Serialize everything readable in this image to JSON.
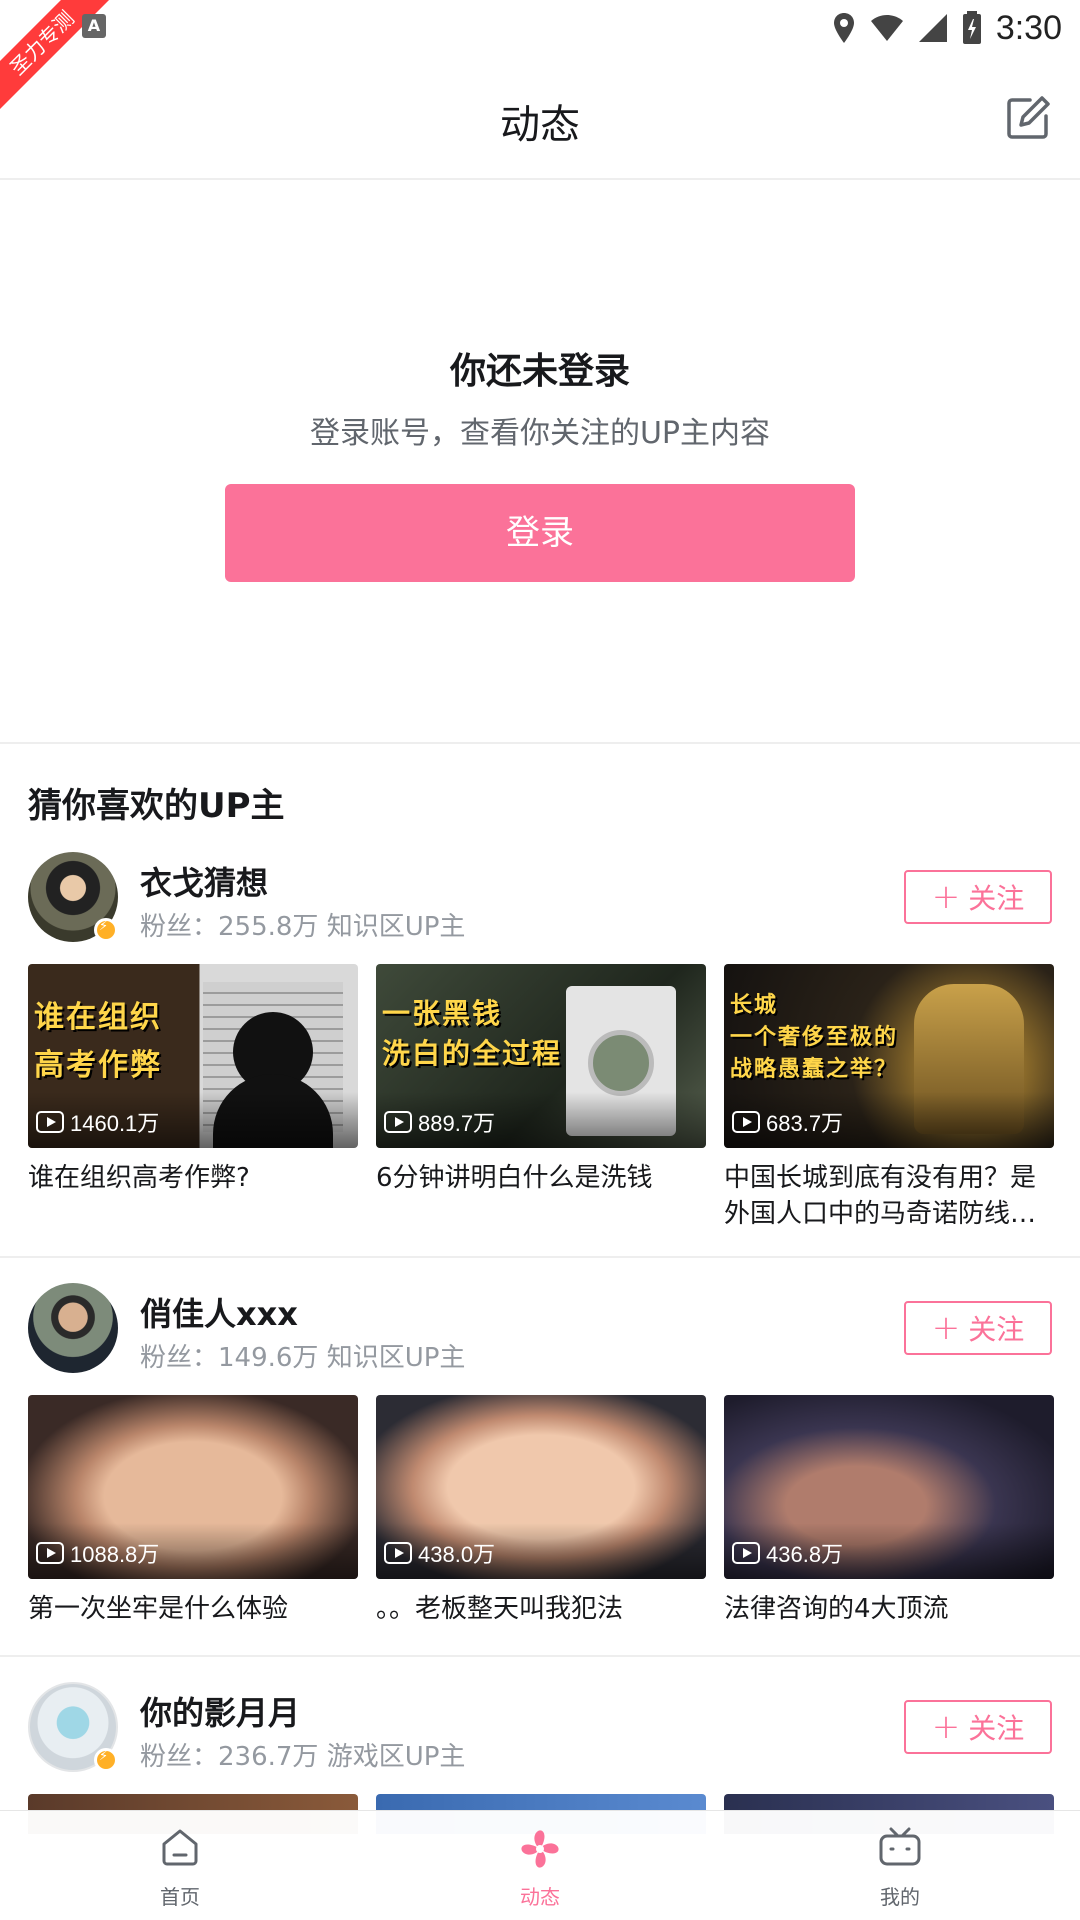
{
  "status_bar": {
    "ribbon": "圣力专测",
    "time": "3:30"
  },
  "header": {
    "title": "动态"
  },
  "login": {
    "title": "你还未登录",
    "subtitle": "登录账号，查看你关注的UP主内容",
    "button": "登录"
  },
  "recommend": {
    "title": "猜你喜欢的UP主",
    "follow_label": "关注",
    "ups": [
      {
        "name": "衣戈猜想",
        "meta": "粉丝：255.8万 知识区UP主",
        "videos": [
          {
            "thumb_text": "谁在组织\n高考作弊",
            "views": "1460.1万",
            "title": "谁在组织高考作弊?"
          },
          {
            "thumb_text": "一张黑钱\n洗白的全过程",
            "views": "889.7万",
            "title": "6分钟讲明白什么是洗钱"
          },
          {
            "thumb_text": "长城\n一个奢侈至极的\n战略愚蠢之举？",
            "views": "683.7万",
            "title": "中国长城到底有没有用？是外国人口中的马奇诺防线…"
          }
        ]
      },
      {
        "name": "俏佳人xxx",
        "meta": "粉丝：149.6万 知识区UP主",
        "videos": [
          {
            "thumb_text": "",
            "views": "1088.8万",
            "title": "第一次坐牢是什么体验"
          },
          {
            "thumb_text": "",
            "views": "438.0万",
            "title": "。。老板整天叫我犯法"
          },
          {
            "thumb_text": "",
            "views": "436.8万",
            "title": "法律咨询的4大顶流"
          }
        ]
      },
      {
        "name": "你的影月月",
        "meta": "粉丝：236.7万 游戏区UP主",
        "videos": []
      }
    ]
  },
  "nav": {
    "items": [
      {
        "label": "首页"
      },
      {
        "label": "动态"
      },
      {
        "label": "我的"
      }
    ]
  },
  "colors": {
    "accent": "#fb7299",
    "text_primary": "#18191c",
    "text_secondary": "#9499a0"
  }
}
